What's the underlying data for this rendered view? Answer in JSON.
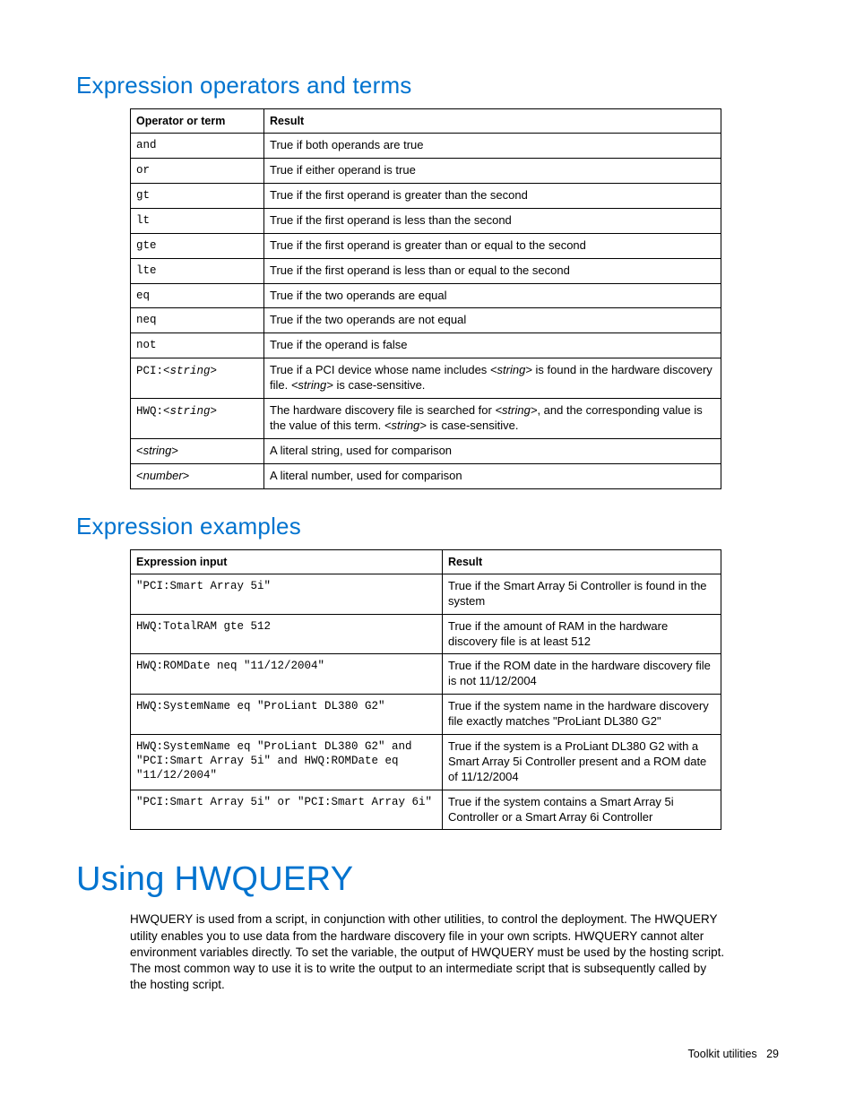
{
  "section1": {
    "title": "Expression operators and terms",
    "headers": [
      "Operator or term",
      "Result"
    ],
    "rows": [
      {
        "op": "and",
        "op_mono": true,
        "res_segments": [
          [
            "",
            "True if both operands are true"
          ]
        ]
      },
      {
        "op": "or",
        "op_mono": true,
        "res_segments": [
          [
            "",
            "True if either operand is true"
          ]
        ]
      },
      {
        "op": "gt",
        "op_mono": true,
        "res_segments": [
          [
            "",
            "True if the first operand is greater than the second"
          ]
        ]
      },
      {
        "op": "lt",
        "op_mono": true,
        "res_segments": [
          [
            "",
            "True if the first operand is less than the second"
          ]
        ]
      },
      {
        "op": "gte",
        "op_mono": true,
        "res_segments": [
          [
            "",
            "True if the first operand is greater than or equal to the second"
          ]
        ]
      },
      {
        "op": "lte",
        "op_mono": true,
        "res_segments": [
          [
            "",
            "True if the first operand is less than or equal to the second"
          ]
        ]
      },
      {
        "op": "eq",
        "op_mono": true,
        "res_segments": [
          [
            "",
            "True if the two operands are equal"
          ]
        ]
      },
      {
        "op": "neq",
        "op_mono": true,
        "res_segments": [
          [
            "",
            "True if the two operands are not equal"
          ]
        ]
      },
      {
        "op": "not",
        "op_mono": true,
        "res_segments": [
          [
            "",
            "True if the operand is false"
          ]
        ]
      },
      {
        "op_html": [
          [
            "mono",
            "PCI:<"
          ],
          [
            "mono italic",
            "string"
          ],
          [
            "mono",
            ">"
          ]
        ],
        "res_segments": [
          [
            "",
            "True if a PCI device whose name includes "
          ],
          [
            "italic",
            "<string>"
          ],
          [
            "",
            " is found in the hardware discovery file. "
          ],
          [
            "italic",
            "<string>"
          ],
          [
            "",
            " is case-sensitive."
          ]
        ]
      },
      {
        "op_html": [
          [
            "mono",
            "HWQ:<"
          ],
          [
            "mono italic",
            "string"
          ],
          [
            "mono",
            ">"
          ]
        ],
        "res_segments": [
          [
            "",
            "The hardware discovery file is searched for "
          ],
          [
            "italic",
            "<string>"
          ],
          [
            "",
            ", and the corresponding value is the value of this term. "
          ],
          [
            "italic",
            "<string>"
          ],
          [
            "",
            " is case-sensitive."
          ]
        ]
      },
      {
        "op_html": [
          [
            "",
            "<"
          ],
          [
            "italic",
            "string"
          ],
          [
            "",
            ">"
          ]
        ],
        "res_segments": [
          [
            "",
            "A literal string, used for comparison"
          ]
        ]
      },
      {
        "op_html": [
          [
            "",
            "<"
          ],
          [
            "italic",
            "number"
          ],
          [
            "",
            ">"
          ]
        ],
        "res_segments": [
          [
            "",
            "A literal number, used for comparison"
          ]
        ]
      }
    ]
  },
  "section2": {
    "title": "Expression examples",
    "headers": [
      "Expression input",
      "Result"
    ],
    "rows": [
      {
        "in": "\"PCI:Smart Array 5i\"",
        "res": "True if the Smart Array 5i Controller is found in the system"
      },
      {
        "in": "HWQ:TotalRAM gte 512",
        "res": "True if the amount of RAM in the hardware discovery file is at least 512"
      },
      {
        "in": "HWQ:ROMDate neq \"11/12/2004\"",
        "res": "True if the ROM date in the hardware discovery file is not 11/12/2004"
      },
      {
        "in": "HWQ:SystemName eq \"ProLiant DL380 G2\"",
        "res": "True if the system name in the hardware discovery file exactly matches \"ProLiant DL380 G2\""
      },
      {
        "in": "HWQ:SystemName eq \"ProLiant DL380 G2\" and \"PCI:Smart Array 5i\" and HWQ:ROMDate eq \"11/12/2004\"",
        "res": "True if the system is a ProLiant DL380 G2 with a Smart Array 5i Controller present and a ROM date of 11/12/2004"
      },
      {
        "in": "\"PCI:Smart Array 5i\" or \"PCI:Smart Array 6i\"",
        "res": "True if the system contains a Smart Array 5i Controller or a Smart Array 6i Controller"
      }
    ]
  },
  "section3": {
    "title": "Using HWQUERY",
    "body": "HWQUERY is used from a script, in conjunction with other utilities, to control the deployment. The HWQUERY utility enables you to use data from the hardware discovery file in your own scripts. HWQUERY cannot alter environment variables directly. To set the variable, the output of HWQUERY must be used by the hosting script. The most common way to use it is to write the output to an intermediate script that is subsequently called by the hosting script."
  },
  "footer": {
    "label": "Toolkit utilities",
    "page": "29"
  }
}
